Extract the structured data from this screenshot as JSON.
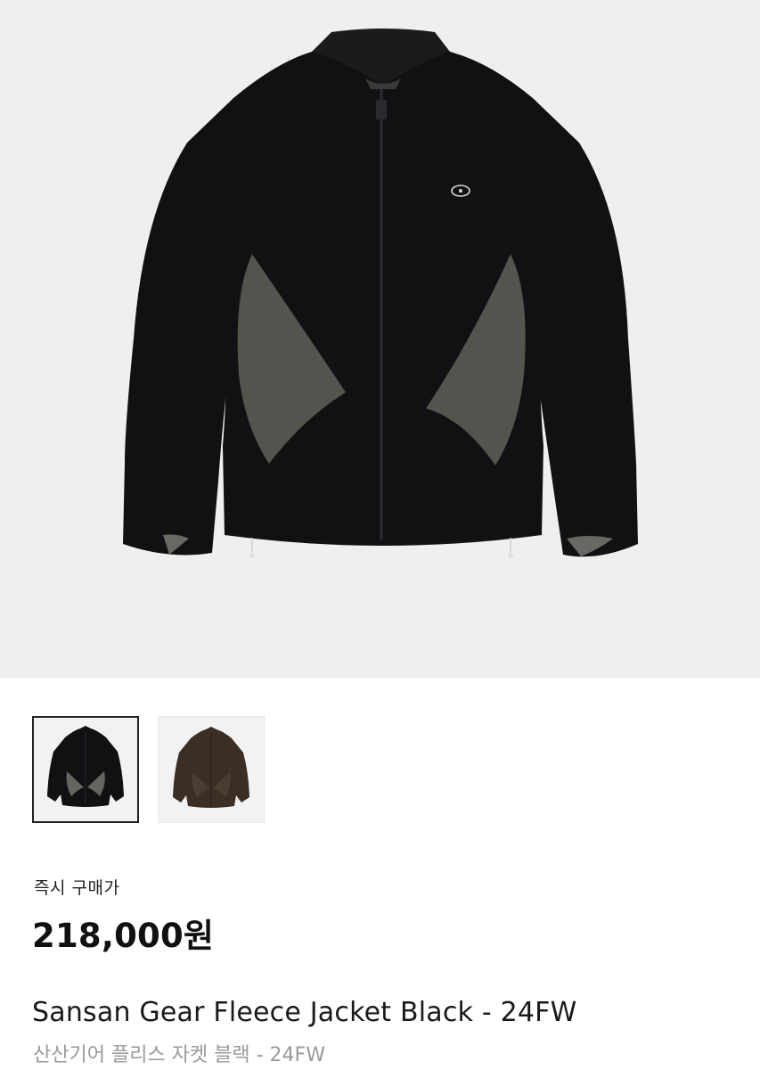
{
  "product": {
    "main_image": {
      "jacket_color": "#111113",
      "panel_color": "#55534d"
    },
    "thumbnails": [
      {
        "name": "Black",
        "jacket_color": "#111113",
        "panel_color": "#66645e",
        "selected": true
      },
      {
        "name": "Brown",
        "jacket_color": "#3a2e25",
        "panel_color": "#4a3d32",
        "selected": false
      }
    ],
    "price_label": "즉시 구매가",
    "price": "218,000원",
    "name_en": "Sansan Gear Fleece Jacket Black - 24FW",
    "name_ko": "산산기어 플리스 자켓 블랙 - 24FW"
  }
}
